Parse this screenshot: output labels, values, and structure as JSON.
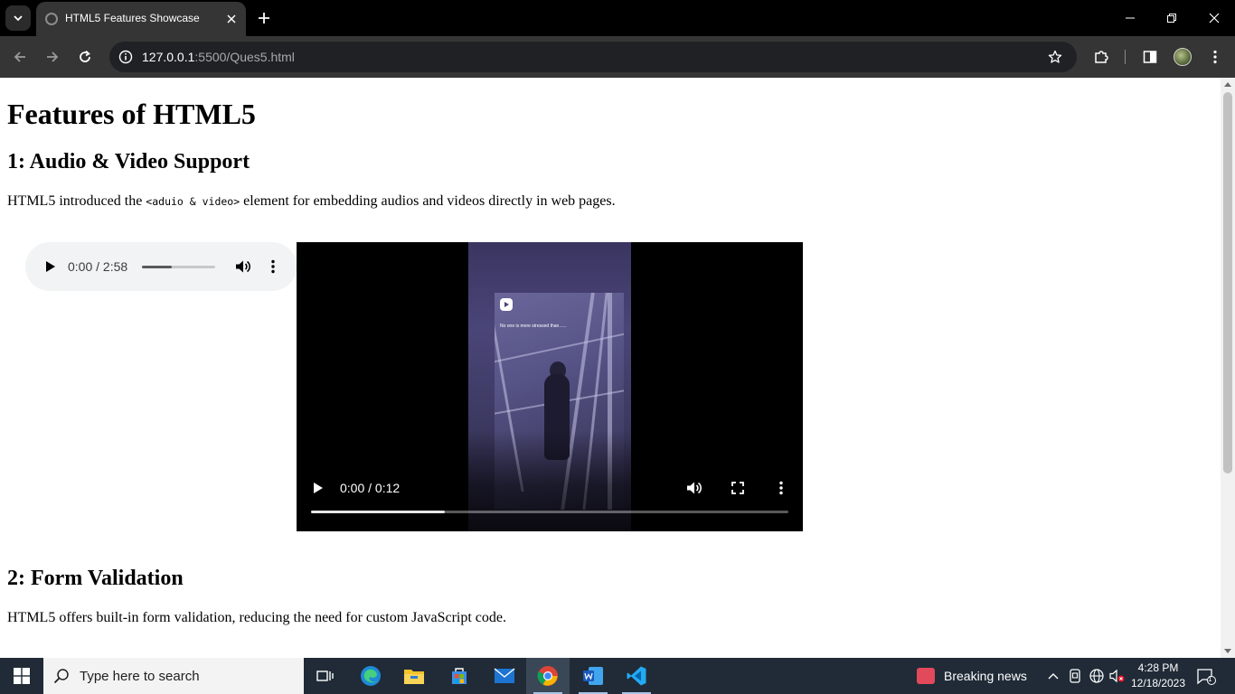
{
  "browser": {
    "tab_title": "HTML5 Features Showcase",
    "url_host": "127.0.0.1",
    "url_path": ":5500/Ques5.html"
  },
  "page": {
    "title": "Features of HTML5",
    "sections": [
      {
        "heading": "1: Audio & Video Support",
        "text_before": "HTML5 introduced the ",
        "code": "<aduio & video>",
        "text_after": " element for embedding audios and videos directly in web pages."
      },
      {
        "heading": "2: Form Validation",
        "text": "HTML5 offers built-in form validation, reducing the need for custom JavaScript code."
      }
    ],
    "audio": {
      "time": "0:00 / 2:58",
      "progress": 0.41
    },
    "video": {
      "time": "0:00 / 0:12",
      "progress": 0.28,
      "caption": "No one is more stressed than......"
    }
  },
  "taskbar": {
    "search_placeholder": "Type here to search",
    "news": "Breaking news",
    "time": "4:28 PM",
    "date": "12/18/2023",
    "notification_count": "1"
  },
  "colors": {
    "chrome_dark": "#353535",
    "taskbar": "#202b37",
    "audio_bg": "#f1f3f4"
  }
}
